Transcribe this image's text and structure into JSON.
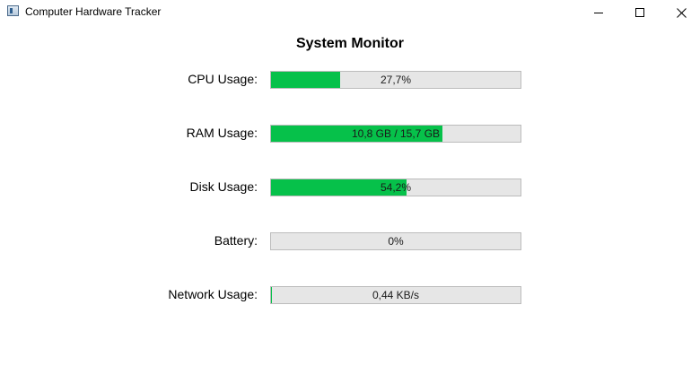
{
  "window": {
    "title": "Computer Hardware Tracker",
    "app_icon": "app-window-icon",
    "controls": {
      "minimize_icon": "minimize-icon",
      "maximize_icon": "maximize-icon",
      "close_icon": "close-icon"
    }
  },
  "heading": "System Monitor",
  "colors": {
    "fill": "#06c14a",
    "track": "#e6e6e6",
    "track_border": "#bcbcbc"
  },
  "metrics": [
    {
      "label": "CPU Usage:",
      "text": "27,7%",
      "fraction": 0.277
    },
    {
      "label": "RAM Usage:",
      "text": "10,8 GB / 15,7 GB",
      "fraction": 0.688
    },
    {
      "label": "Disk Usage:",
      "text": "54,2%",
      "fraction": 0.542
    },
    {
      "label": "Battery:",
      "text": "0%",
      "fraction": 0.0
    },
    {
      "label": "Network Usage:",
      "text": "0,44 KB/s",
      "fraction": 0.004
    }
  ]
}
